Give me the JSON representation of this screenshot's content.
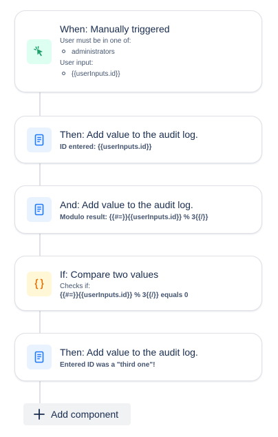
{
  "colors": {
    "trigger_icon": "#22a06b",
    "action_icon": "#1d7afc",
    "condition_icon": "#e2740b",
    "title_text": "#172b4d",
    "secondary_text": "#44546f",
    "connector": "#dfe1e6"
  },
  "rules": [
    {
      "kind": "trigger",
      "icon": "cursor-click-icon",
      "title": "When: Manually triggered",
      "restriction_label": "User must be in one of:",
      "restriction_values": [
        "administrators"
      ],
      "input_label": "User input:",
      "input_values": [
        "{{userInputs.id}}"
      ]
    },
    {
      "kind": "action",
      "icon": "document-icon",
      "title": "Then: Add value to the audit log.",
      "detail": "ID entered: {{userInputs.id}}"
    },
    {
      "kind": "action",
      "icon": "document-icon",
      "title": "And: Add value to the audit log.",
      "detail": "Modulo result: {{#=}}{{userInputs.id}} % 3{{/}}"
    },
    {
      "kind": "condition",
      "icon": "braces-icon",
      "title": "If: Compare two values",
      "checks_label": "Checks if:",
      "detail": "{{#=}}{{userInputs.id}} % 3{{/}} equals 0"
    },
    {
      "kind": "action",
      "icon": "document-icon",
      "title": "Then: Add value to the audit log.",
      "detail": "Entered ID was a \"third one\"!"
    }
  ],
  "add_component": {
    "icon": "plus-icon",
    "label": "Add component"
  }
}
